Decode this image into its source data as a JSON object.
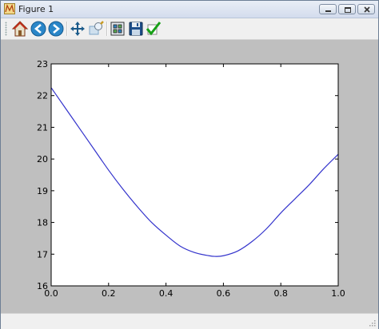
{
  "window": {
    "title": "Figure 1"
  },
  "toolbar": {
    "tools": [
      {
        "name": "home-icon"
      },
      {
        "name": "back-arrow-icon"
      },
      {
        "name": "forward-arrow-icon"
      },
      {
        "name": "pan-icon"
      },
      {
        "name": "zoom-icon"
      },
      {
        "name": "configure-subplots-icon"
      },
      {
        "name": "save-icon"
      },
      {
        "name": "edit-checkmark-icon"
      }
    ]
  },
  "chart_data": {
    "type": "line",
    "title": "",
    "xlabel": "",
    "ylabel": "",
    "xlim": [
      0.0,
      1.0
    ],
    "ylim": [
      16,
      23
    ],
    "xticks": [
      "0.0",
      "0.2",
      "0.4",
      "0.6",
      "0.8",
      "1.0"
    ],
    "yticks": [
      "16",
      "17",
      "18",
      "19",
      "20",
      "21",
      "22",
      "23"
    ],
    "grid": false,
    "series": [
      {
        "color": "#3333cc",
        "x": [
          0.0,
          0.05,
          0.1,
          0.15,
          0.2,
          0.25,
          0.3,
          0.35,
          0.4,
          0.45,
          0.5,
          0.55,
          0.57,
          0.6,
          0.65,
          0.7,
          0.75,
          0.8,
          0.85,
          0.9,
          0.95,
          1.0
        ],
        "y": [
          22.25,
          21.6,
          20.95,
          20.3,
          19.65,
          19.05,
          18.5,
          18.0,
          17.6,
          17.25,
          17.05,
          16.95,
          16.93,
          16.95,
          17.1,
          17.4,
          17.8,
          18.3,
          18.75,
          19.2,
          19.7,
          20.15
        ]
      }
    ]
  }
}
